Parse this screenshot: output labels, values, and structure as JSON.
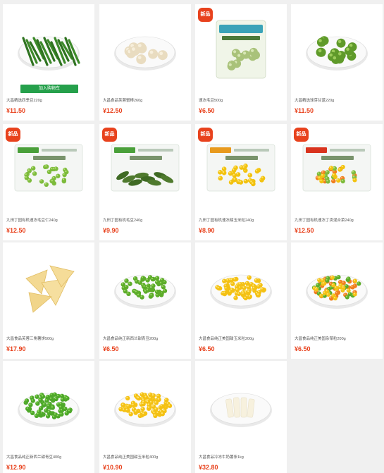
{
  "colors": {
    "accent_red": "#e8421d",
    "cart_green": "#25a04b",
    "background": "#f0f0f0"
  },
  "cart_button_label": "加入购物车",
  "new_badge_label": "新品",
  "products": [
    {
      "title": "大昌精选四季豆220g",
      "price": "¥11.50",
      "is_new": false,
      "show_cart": true,
      "image": "green-beans-plate"
    },
    {
      "title": "大昌食品芙蓉蟹棒260g",
      "price": "¥12.50",
      "is_new": false,
      "show_cart": false,
      "image": "crab-balls-plate"
    },
    {
      "title": "速冻毛豆500g",
      "price": "¥6.50",
      "is_new": true,
      "show_cart": false,
      "image": "edamame-bag"
    },
    {
      "title": "大昌精选球芽甘蓝220g",
      "price": "¥11.50",
      "is_new": false,
      "show_cart": false,
      "image": "brussels-sprouts-plate"
    },
    {
      "title": "九田丁园有机速冻毛豆仁240g",
      "price": "¥12.50",
      "is_new": true,
      "show_cart": false,
      "image": "organic-peas-bag"
    },
    {
      "title": "九田丁园有机毛豆240g",
      "price": "¥9.90",
      "is_new": true,
      "show_cart": false,
      "image": "organic-edamame-bag"
    },
    {
      "title": "九田丁园有机速冻甜玉米粒240g",
      "price": "¥8.90",
      "is_new": true,
      "show_cart": false,
      "image": "organic-corn-bag"
    },
    {
      "title": "九田丁园有机速冻丁类混合菜240g",
      "price": "¥12.50",
      "is_new": true,
      "show_cart": false,
      "image": "organic-mixed-veg-bag"
    },
    {
      "title": "大昌食品芙蓉三角薯饼500g",
      "price": "¥17.90",
      "is_new": false,
      "show_cart": false,
      "image": "hash-browns-plate"
    },
    {
      "title": "大昌食品纯正新西兰甜青豆200g",
      "price": "¥6.50",
      "is_new": false,
      "show_cart": false,
      "image": "peas-plate"
    },
    {
      "title": "大昌食品纯正美国甜玉米粒200g",
      "price": "¥6.50",
      "is_new": false,
      "show_cart": false,
      "image": "corn-plate"
    },
    {
      "title": "大昌食品纯正美国杂菜粒200g",
      "price": "¥6.50",
      "is_new": false,
      "show_cart": false,
      "image": "mixed-veg-plate"
    },
    {
      "title": "大昌食品纯正新西兰甜青豆400g",
      "price": "¥12.90",
      "is_new": false,
      "show_cart": false,
      "image": "peas-plate-large"
    },
    {
      "title": "大昌食品纯正美国甜玉米粒400g",
      "price": "¥10.90",
      "is_new": false,
      "show_cart": false,
      "image": "corn-plate-large"
    },
    {
      "title": "大昌食品冷冻牛奶薯条1kg",
      "price": "¥32.80",
      "is_new": false,
      "show_cart": false,
      "image": "fries-plate"
    }
  ]
}
